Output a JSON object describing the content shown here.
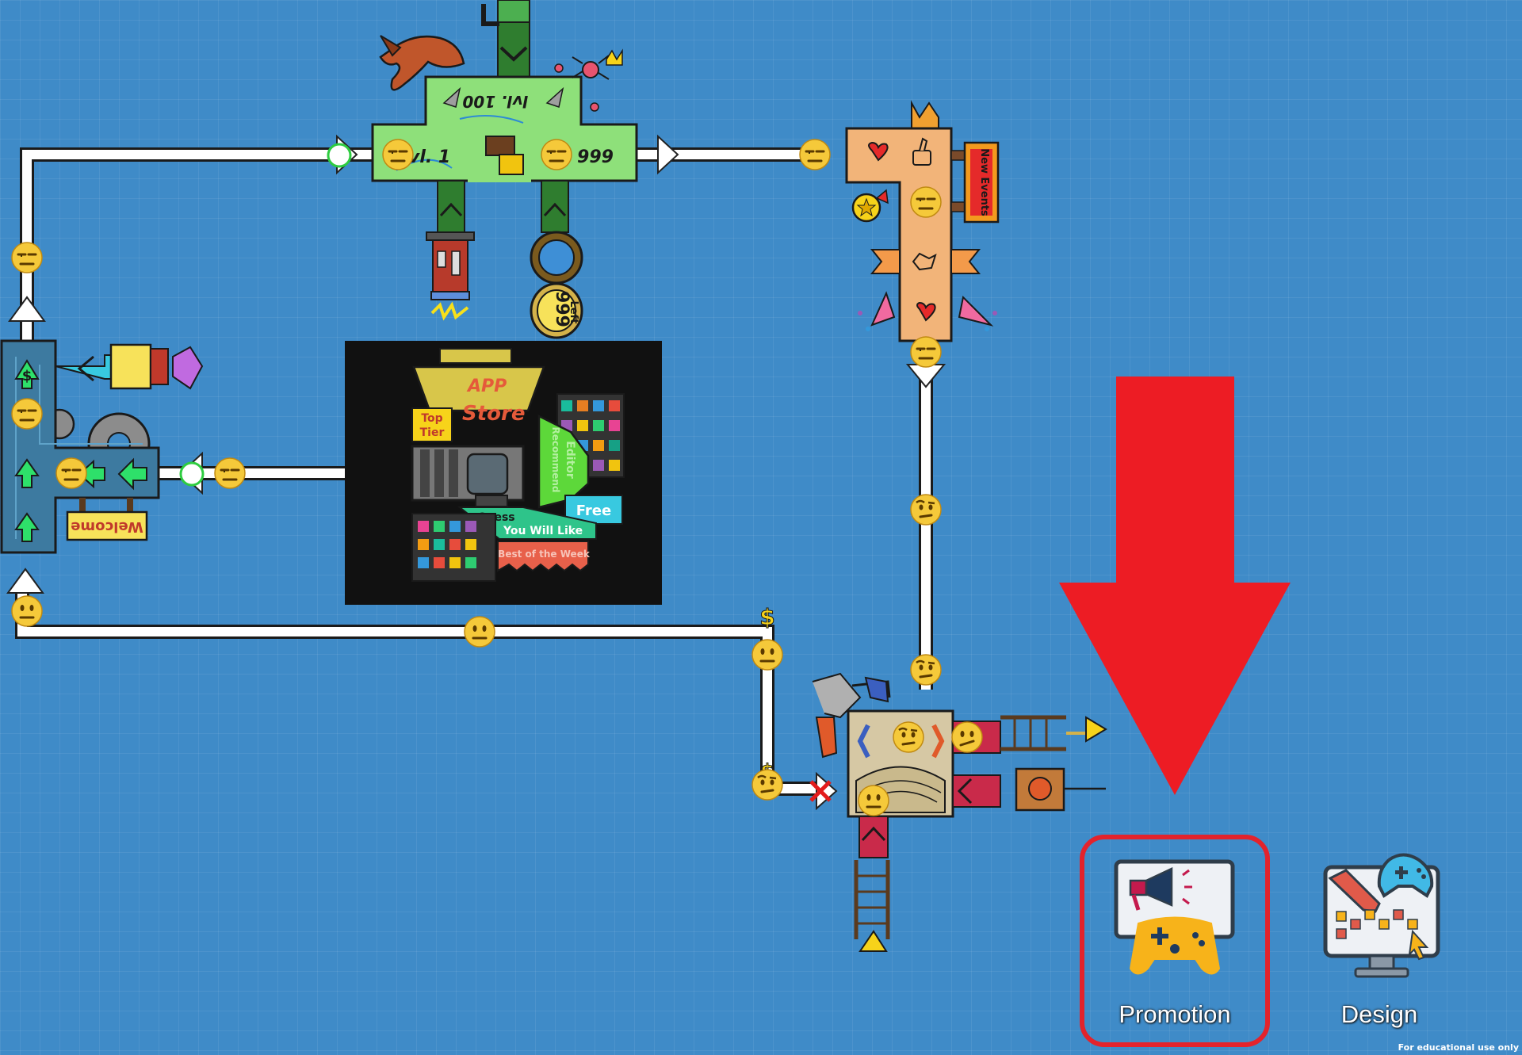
{
  "board": {
    "level_labels": {
      "bottom_left": "vl. 1",
      "top": "lvl. 100",
      "bottom_right": ". 999"
    },
    "counter_value": "999",
    "counter_unit": "Left",
    "sign_welcome": "Welcome",
    "event_sign": "New Events",
    "currency_symbol": "$",
    "app_store": {
      "title_line1": "APP",
      "title_line2": "Store",
      "tag_top_line1": "Top",
      "tag_top_line2": "Tier",
      "tag_free": "Free",
      "tag_guess_line1": "Guess",
      "tag_guess_line2": "You Will Like",
      "tag_best": "Best of the Week",
      "editor_tag_line1": "Editor",
      "editor_tag_line2": "Recommend"
    }
  },
  "toolbar": {
    "items": [
      {
        "label": "Promotion",
        "icon": "megaphone-gamepad-icon",
        "selected": true
      },
      {
        "label": "Design",
        "icon": "monitor-design-icon",
        "selected": false
      }
    ]
  },
  "annotation": {
    "arrow_color": "#ed1c24",
    "highlight_color": "#e3232c"
  },
  "footer_note": "For educational use only"
}
